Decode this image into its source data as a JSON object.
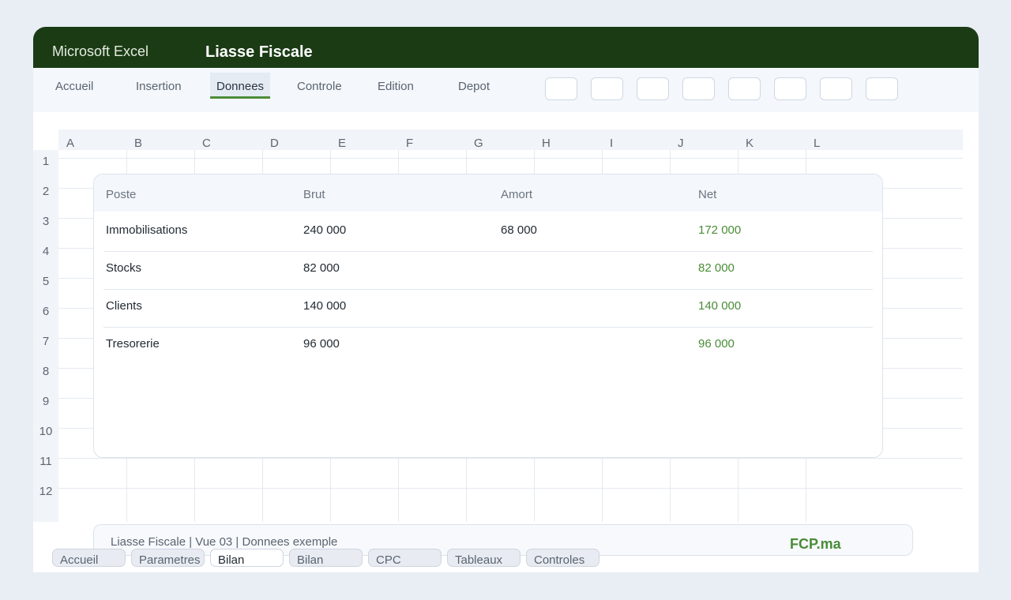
{
  "titlebar": {
    "app_name": "Microsoft Excel",
    "doc_title": "Liasse Fiscale"
  },
  "ribbon": {
    "tabs": [
      {
        "label": "Accueil"
      },
      {
        "label": "Insertion"
      },
      {
        "label": "Donnees",
        "active": true
      },
      {
        "label": "Controle"
      },
      {
        "label": "Edition"
      },
      {
        "label": "Depot"
      }
    ],
    "button_count": 8
  },
  "grid": {
    "columns": [
      "A",
      "B",
      "C",
      "D",
      "E",
      "F",
      "G",
      "H",
      "I",
      "J",
      "K",
      "L"
    ],
    "rows": [
      "1",
      "2",
      "3",
      "4",
      "5",
      "6",
      "7",
      "8",
      "9",
      "10",
      "11",
      "12"
    ]
  },
  "table": {
    "headers": {
      "poste": "Poste",
      "brut": "Brut",
      "amort": "Amort",
      "net": "Net"
    },
    "rows": [
      {
        "poste": "Immobilisations",
        "brut": "240 000",
        "amort": "68 000",
        "net": "172 000"
      },
      {
        "poste": "Stocks",
        "brut": "82 000",
        "amort": "",
        "net": "82 000"
      },
      {
        "poste": "Clients",
        "brut": "140 000",
        "amort": "",
        "net": "140 000"
      },
      {
        "poste": "Tresorerie",
        "brut": "96 000",
        "amort": "",
        "net": "96 000"
      }
    ]
  },
  "statusbar": {
    "text": "Liasse Fiscale | Vue 03 | Donnees exemple",
    "brand": "FCP.ma"
  },
  "sheet_tabs": [
    {
      "label": "Accueil"
    },
    {
      "label": "Parametres"
    },
    {
      "label": "Bilan",
      "active": true
    },
    {
      "label": "Bilan"
    },
    {
      "label": "CPC"
    },
    {
      "label": "Tableaux"
    },
    {
      "label": "Controles"
    }
  ],
  "colors": {
    "titlebar": "#1b3b15",
    "accent": "#4e8c3a",
    "net_value": "#4a8c37"
  }
}
